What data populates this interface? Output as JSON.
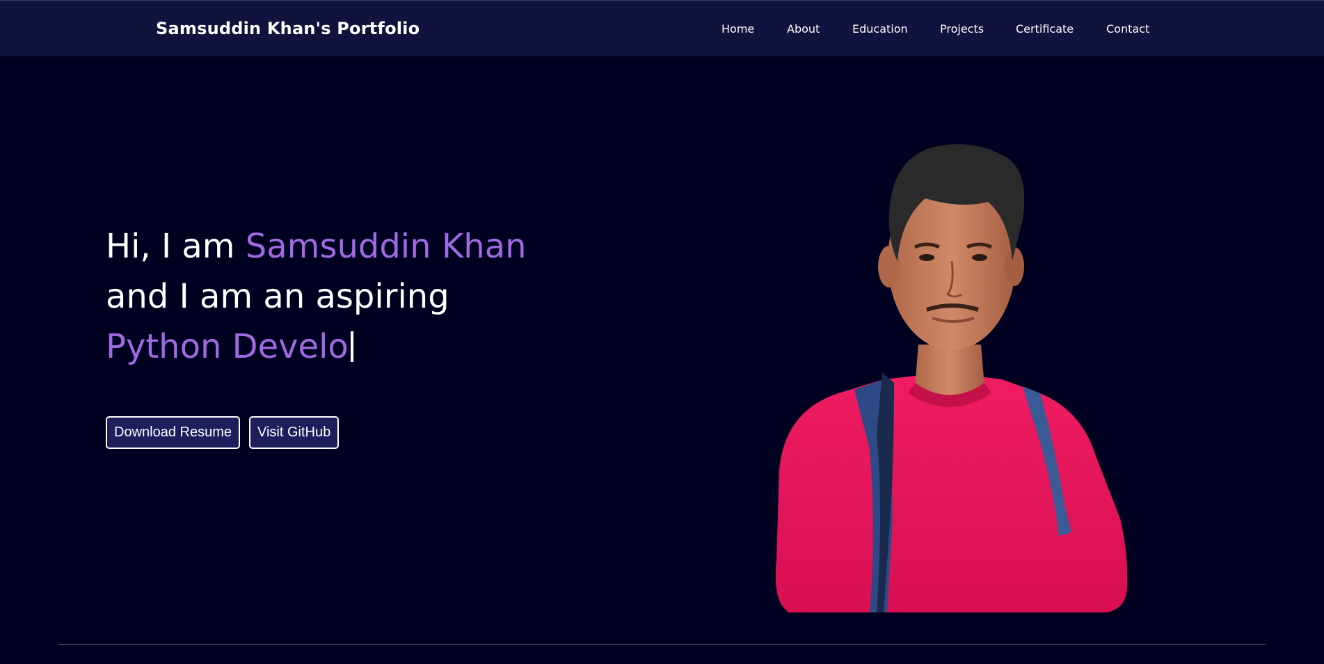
{
  "navbar": {
    "brand": "Samsuddin Khan's Portfolio",
    "links": [
      {
        "label": "Home"
      },
      {
        "label": "About"
      },
      {
        "label": "Education"
      },
      {
        "label": "Projects"
      },
      {
        "label": "Certificate"
      },
      {
        "label": "Contact"
      }
    ]
  },
  "hero": {
    "greeting": "Hi, I am ",
    "name": "Samsuddin Khan",
    "line2": "and I am an aspiring",
    "typed_role": "Python Develo",
    "buttons": {
      "resume": "Download Resume",
      "github": "Visit GitHub"
    }
  },
  "colors": {
    "background": "#000020",
    "navbar": "#11123d",
    "accent": "#a06ae0",
    "button_bg": "#1d1f5c",
    "shirt": "#e8145a"
  },
  "icons": {
    "portrait": "profile-photo"
  }
}
